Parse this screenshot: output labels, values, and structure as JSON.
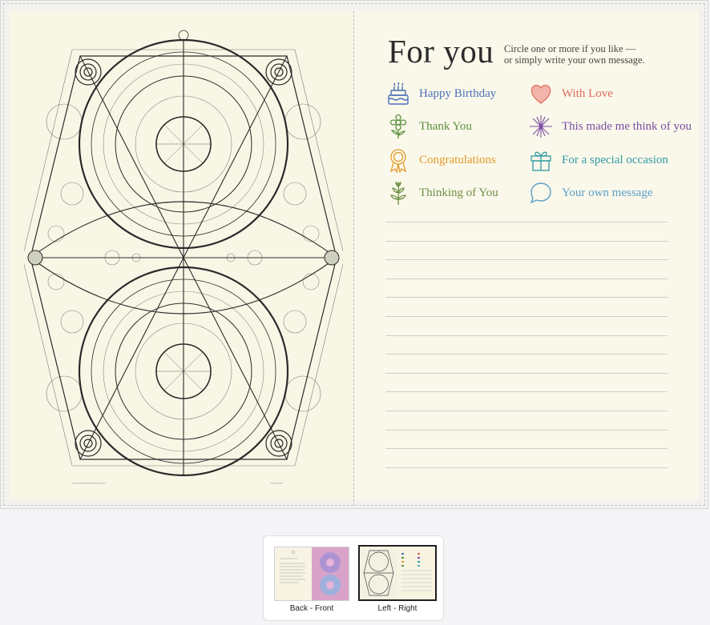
{
  "right_panel": {
    "title": "For you",
    "subtitle_line1": "Circle one or more if you like —",
    "subtitle_line2": "or simply write your own message."
  },
  "options": [
    {
      "label": "Happy Birthday",
      "icon": "birthday-cake-icon",
      "color": "#4a6fb8"
    },
    {
      "label": "With Love",
      "icon": "heart-icon",
      "color": "#e06b5c"
    },
    {
      "label": "Thank You",
      "icon": "flower-icon",
      "color": "#5b8f3e"
    },
    {
      "label": "This made me think of you",
      "icon": "sparkle-icon",
      "color": "#7b4fa6"
    },
    {
      "label": "Congratulations",
      "icon": "award-ribbon-icon",
      "color": "#e39a2a"
    },
    {
      "label": "For a special occasion",
      "icon": "gift-icon",
      "color": "#2f9aa4"
    },
    {
      "label": "Thinking of You",
      "icon": "plant-sprig-icon",
      "color": "#6f8f48"
    },
    {
      "label": "Your own message",
      "icon": "speech-bubble-icon",
      "color": "#5a9fc9"
    }
  ],
  "writing_lines": 14,
  "thumbnails": [
    {
      "label": "Back - Front",
      "selected": false
    },
    {
      "label": "Left - Right",
      "selected": true
    }
  ],
  "colors": {
    "panel_left_bg": "#f8f7e6",
    "panel_right_bg": "#faf8ea",
    "selected_border": "#1f1f1f"
  }
}
